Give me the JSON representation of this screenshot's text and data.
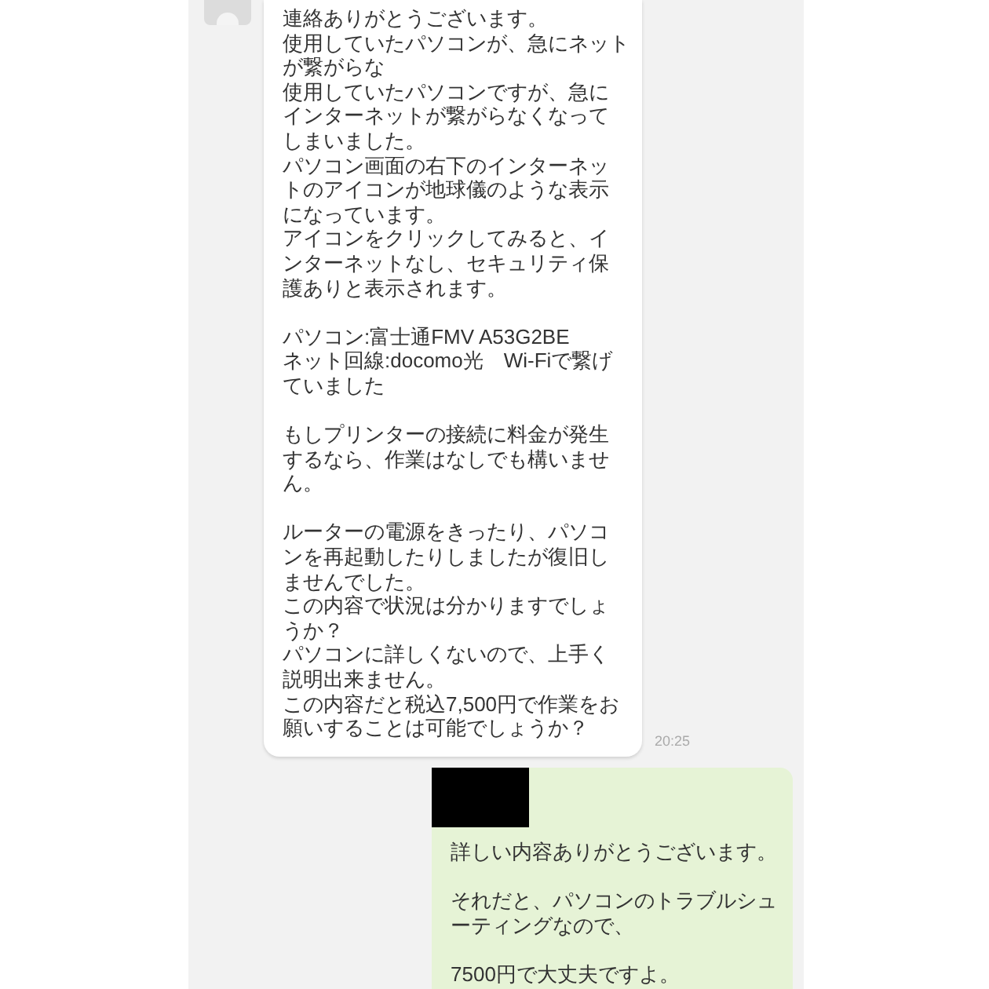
{
  "messages": [
    {
      "kind": "incoming",
      "redacted": false,
      "paragraphs": [
        [
          "連絡ありがとうございます。",
          "使用していたパソコンが、急にネット",
          "が繋がらな",
          "使用していたパソコンですが、急に",
          "インターネットが繋がらなくなって",
          "しまいました。",
          "パソコン画面の右下のインターネッ",
          "トのアイコンが地球儀のような表示",
          "になっています。",
          "アイコンをクリックしてみると、イ",
          "ンターネットなし、セキュリティ保",
          "護ありと表示されます。"
        ],
        [
          "パソコン:富士通FMV A53G2BE",
          "ネット回線:docomo光　Wi-Fiで繋げ",
          "ていました"
        ],
        [
          "もしプリンターの接続に料金が発生",
          "するなら、作業はなしでも構いませ",
          "ん。"
        ],
        [
          "ルーターの電源をきったり、パソコ",
          "ンを再起動したりしましたが復旧し",
          "ませんでした。",
          "この内容で状況は分かりますでしょ",
          "うか？",
          "パソコンに詳しくないので、上手く",
          "説明出来ません。",
          "この内容だと税込7,500円で作業をお",
          "願いすることは可能でしょうか？"
        ]
      ],
      "time": "20:25"
    },
    {
      "kind": "outgoing",
      "redacted": true,
      "paragraphs": [
        [
          "詳しい内容ありがとうございます。"
        ],
        [
          "それだと、パソコンのトラブルシュ",
          "ーティングなので、"
        ],
        [
          "7500円で大丈夫ですよ。"
        ]
      ]
    }
  ]
}
